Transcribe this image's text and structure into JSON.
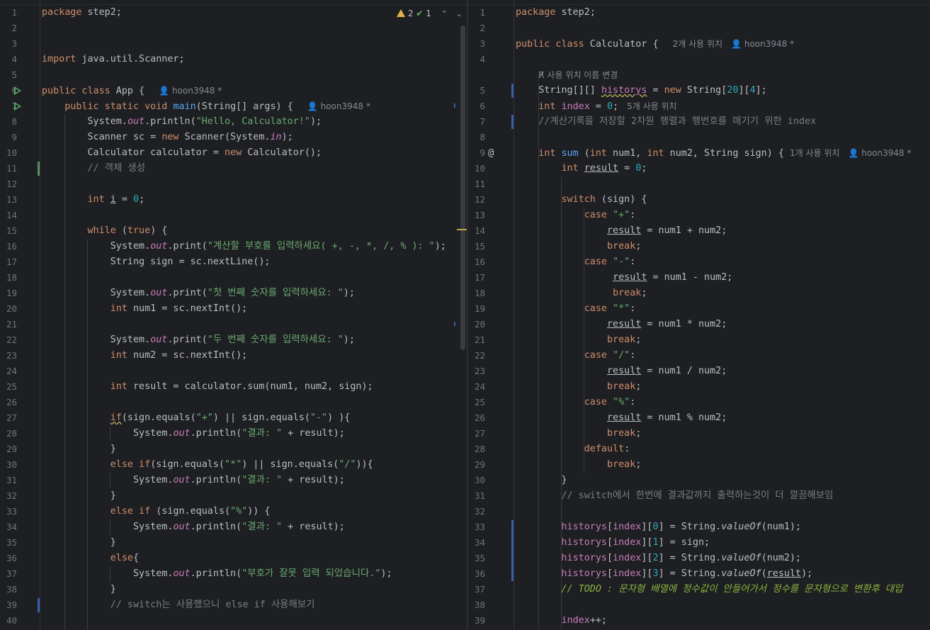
{
  "left_editor": {
    "inspection": {
      "warnings": "2",
      "weak_warnings": "1",
      "warning_icon": "warning-triangle-icon",
      "weak_icon": "checkmark-icon",
      "up_icon": "chevron-up-icon",
      "down_icon": "chevron-down-icon"
    },
    "line_numbers": [
      "1",
      "2",
      "3",
      "4",
      "5",
      "6",
      "7",
      "8",
      "9",
      "10",
      "11",
      "12",
      "13",
      "14",
      "15",
      "16",
      "17",
      "18",
      "19",
      "20",
      "21",
      "22",
      "23",
      "24",
      "25",
      "26",
      "27",
      "28",
      "29",
      "30",
      "31",
      "32",
      "33",
      "34",
      "35",
      "36",
      "37",
      "38",
      "39",
      "40"
    ],
    "lines": {
      "l1": {
        "kw": "package",
        "rest": " step2;"
      },
      "l4": {
        "kw": "import",
        "rest": " java.util.Scanner;"
      },
      "l6": {
        "kw": "public class",
        "rest": " App { ",
        "hint": "hoon3948 *"
      },
      "l7": {
        "kw": "public static void",
        "fn": "main",
        "rest": "(String[] args) { ",
        "hint": "hoon3948 *"
      },
      "l8": {
        "pre": "System.",
        "fld": "out",
        "mid": ".println(",
        "str": "\"Hello, Calculator!\"",
        "post": ");"
      },
      "l9": {
        "pre": "Scanner sc = ",
        "kw": "new",
        "mid": " Scanner(System.",
        "fld": "in",
        "post": ");"
      },
      "l10": {
        "pre": "Calculator calculator = ",
        "kw": "new",
        "post": " Calculator();"
      },
      "l11": {
        "cmt": "// 객체 생성"
      },
      "l13": {
        "kw": "int",
        "var": "i",
        "mid": " = ",
        "num": "0",
        "post": ";"
      },
      "l15": {
        "kw": "while",
        "mid": " (",
        "kw2": "true",
        "post": ") {"
      },
      "l16": {
        "pre": "System.",
        "fld": "out",
        "mid": ".print(",
        "str": "\"계산할 부호를 입력하세요( +, -, *, /, % ): \"",
        "post": ");"
      },
      "l17": {
        "text": "String sign = sc.nextLine();"
      },
      "l19": {
        "pre": "System.",
        "fld": "out",
        "mid": ".print(",
        "str": "\"첫 번째 숫자를 입력하세요: \"",
        "post": ");"
      },
      "l20": {
        "kw": "int",
        "post": " num1 = sc.nextInt();"
      },
      "l22": {
        "pre": "System.",
        "fld": "out",
        "mid": ".print(",
        "str": "\"두 번째 숫자를 입력하세요: \"",
        "post": ");"
      },
      "l23": {
        "kw": "int",
        "post": " num2 = sc.nextInt();"
      },
      "l25": {
        "kw": "int",
        "post": " result = calculator.sum(num1, num2, sign);"
      },
      "l27": {
        "kw": "if",
        "mid": "(sign.equals(",
        "str": "\"+\"",
        "mid2": ") || sign.equals(",
        "str2": "\"-\"",
        "post": ") ){"
      },
      "l28": {
        "pre": "System.",
        "fld": "out",
        "mid": ".println(",
        "str": "\"결과: \"",
        "post": " + result);"
      },
      "l29": {
        "text": "}"
      },
      "l30": {
        "kw": "else if",
        "mid": "(sign.equals(",
        "str": "\"*\"",
        "mid2": ") || sign.equals(",
        "str2": "\"/\"",
        "post": ")){"
      },
      "l31": {
        "pre": "System.",
        "fld": "out",
        "mid": ".println(",
        "str": "\"결과: \"",
        "post": " + result);"
      },
      "l32": {
        "text": "}"
      },
      "l33": {
        "kw": "else if",
        "mid": " (sign.equals(",
        "str": "\"%\"",
        "post": ")) {"
      },
      "l34": {
        "pre": "System.",
        "fld": "out",
        "mid": ".println(",
        "str": "\"결과: \"",
        "post": " + result);"
      },
      "l35": {
        "text": "}"
      },
      "l36": {
        "kw": "else",
        "post": "{"
      },
      "l37": {
        "pre": "System.",
        "fld": "out",
        "mid": ".println(",
        "str": "\"부호가 잘못 입력 되었습니다.\"",
        "post": ");"
      },
      "l38": {
        "text": "}"
      },
      "l39": {
        "cmt": "// switch는 사용했으니 else if 사용해보기"
      }
    }
  },
  "right_editor": {
    "line_numbers": [
      "1",
      "2",
      "3",
      "4",
      "",
      "5",
      "6",
      "7",
      "8",
      "9",
      "10",
      "11",
      "12",
      "13",
      "14",
      "15",
      "16",
      "17",
      "18",
      "19",
      "20",
      "21",
      "22",
      "23",
      "24",
      "25",
      "26",
      "27",
      "28",
      "29",
      "30",
      "31",
      "32",
      "33",
      "34",
      "35",
      "36",
      "37",
      "38",
      "39"
    ],
    "lines": {
      "r1": {
        "kw": "package",
        "rest": " step2;"
      },
      "r3": {
        "kw": "public class",
        "rest": " Calculator { ",
        "hint": "2개 사용 위치",
        "hint2": "hoon3948 *"
      },
      "rhint": {
        "text": "사용 위치 이름 변경",
        "icon": "rename-icon"
      },
      "r5": {
        "pre": "String[][] ",
        "fld": "historys",
        "mid": " = ",
        "kw": "new",
        "mid2": " String[",
        "num": "20",
        "mid3": "][",
        "num2": "4",
        "post": "];"
      },
      "r6": {
        "kw": "int",
        "fld": " index",
        "mid": " = ",
        "num": "0",
        "post": ";",
        "hint": "5개 사용 위치"
      },
      "r7": {
        "cmt": "//계산기록을 저장할 2차원 행렬과 행번호를 매기기 위한 index"
      },
      "r9": {
        "kw": "int",
        "fn": " sum",
        "mid": " (",
        "kw2": "int",
        "mid2": " num1, ",
        "kw3": "int",
        "post": " num2, String sign) { ",
        "hint": "1개 사용 위치",
        "hint2": "hoon3948 *"
      },
      "r10": {
        "kw": "int",
        "var": "result",
        "mid": " = ",
        "num": "0",
        "post": ";"
      },
      "r12": {
        "kw": "switch",
        "post": " (sign) {"
      },
      "r13": {
        "kw": "case",
        "str": " \"+\"",
        "post": ":"
      },
      "r14": {
        "var": "result",
        "post": " = num1 + num2;"
      },
      "r15": {
        "kw": "break",
        "post": ";"
      },
      "r16": {
        "kw": "case",
        "str": " \"-\"",
        "post": ":"
      },
      "r17": {
        "var": "result",
        "post": " = num1 - num2;"
      },
      "r18": {
        "kw": "break",
        "post": ";"
      },
      "r19": {
        "kw": "case",
        "str": " \"*\"",
        "post": ":"
      },
      "r20": {
        "var": "result",
        "post": " = num1 * num2;"
      },
      "r21": {
        "kw": "break",
        "post": ";"
      },
      "r22": {
        "kw": "case",
        "str": " \"/\"",
        "post": ":"
      },
      "r23": {
        "var": "result",
        "post": " = num1 / num2;"
      },
      "r24": {
        "kw": "break",
        "post": ";"
      },
      "r25": {
        "kw": "case",
        "str": " \"%\"",
        "post": ":"
      },
      "r26": {
        "var": "result",
        "post": " = num1 % num2;"
      },
      "r27": {
        "kw": "break",
        "post": ";"
      },
      "r28": {
        "kw": "default",
        "post": ":"
      },
      "r29": {
        "kw": "break",
        "post": ";"
      },
      "r30": {
        "text": "}"
      },
      "r31": {
        "cmt": "// switch에서 한번에 결과값까지 출력하는것이 더 깔끔해보임"
      },
      "r33": {
        "fld": "historys",
        "mid": "[",
        "fld2": "index",
        "mid2": "][",
        "num": "0",
        "mid3": "] = String.",
        "it": "valueOf",
        "post": "(num1);"
      },
      "r34": {
        "fld": "historys",
        "mid": "[",
        "fld2": "index",
        "mid2": "][",
        "num": "1",
        "post": "] = sign;"
      },
      "r35": {
        "fld": "historys",
        "mid": "[",
        "fld2": "index",
        "mid2": "][",
        "num": "2",
        "mid3": "] = String.",
        "it": "valueOf",
        "post": "(num2);"
      },
      "r36": {
        "fld": "historys",
        "mid": "[",
        "fld2": "index",
        "mid2": "][",
        "num": "3",
        "mid3": "] = String.",
        "it": "valueOf",
        "pre2": "(",
        "var": "result",
        "post": ");"
      },
      "r37": {
        "cmt": "// ",
        "todo": "TODO : 문자형 배열에 정수값이 안들어가서 정수를 문자형으로 변환후 대입"
      },
      "r39": {
        "fld": "index",
        "post": "++;"
      }
    }
  },
  "colors": {
    "background": "#1e1f22",
    "keyword": "#cf8e6d",
    "string": "#6aab73",
    "number": "#2aacb8",
    "field": "#c77dbb",
    "function": "#56a8f5",
    "comment": "#7a7e85",
    "text": "#bcbec4",
    "vcs_added": "#549159",
    "vcs_modified": "#375fad"
  }
}
